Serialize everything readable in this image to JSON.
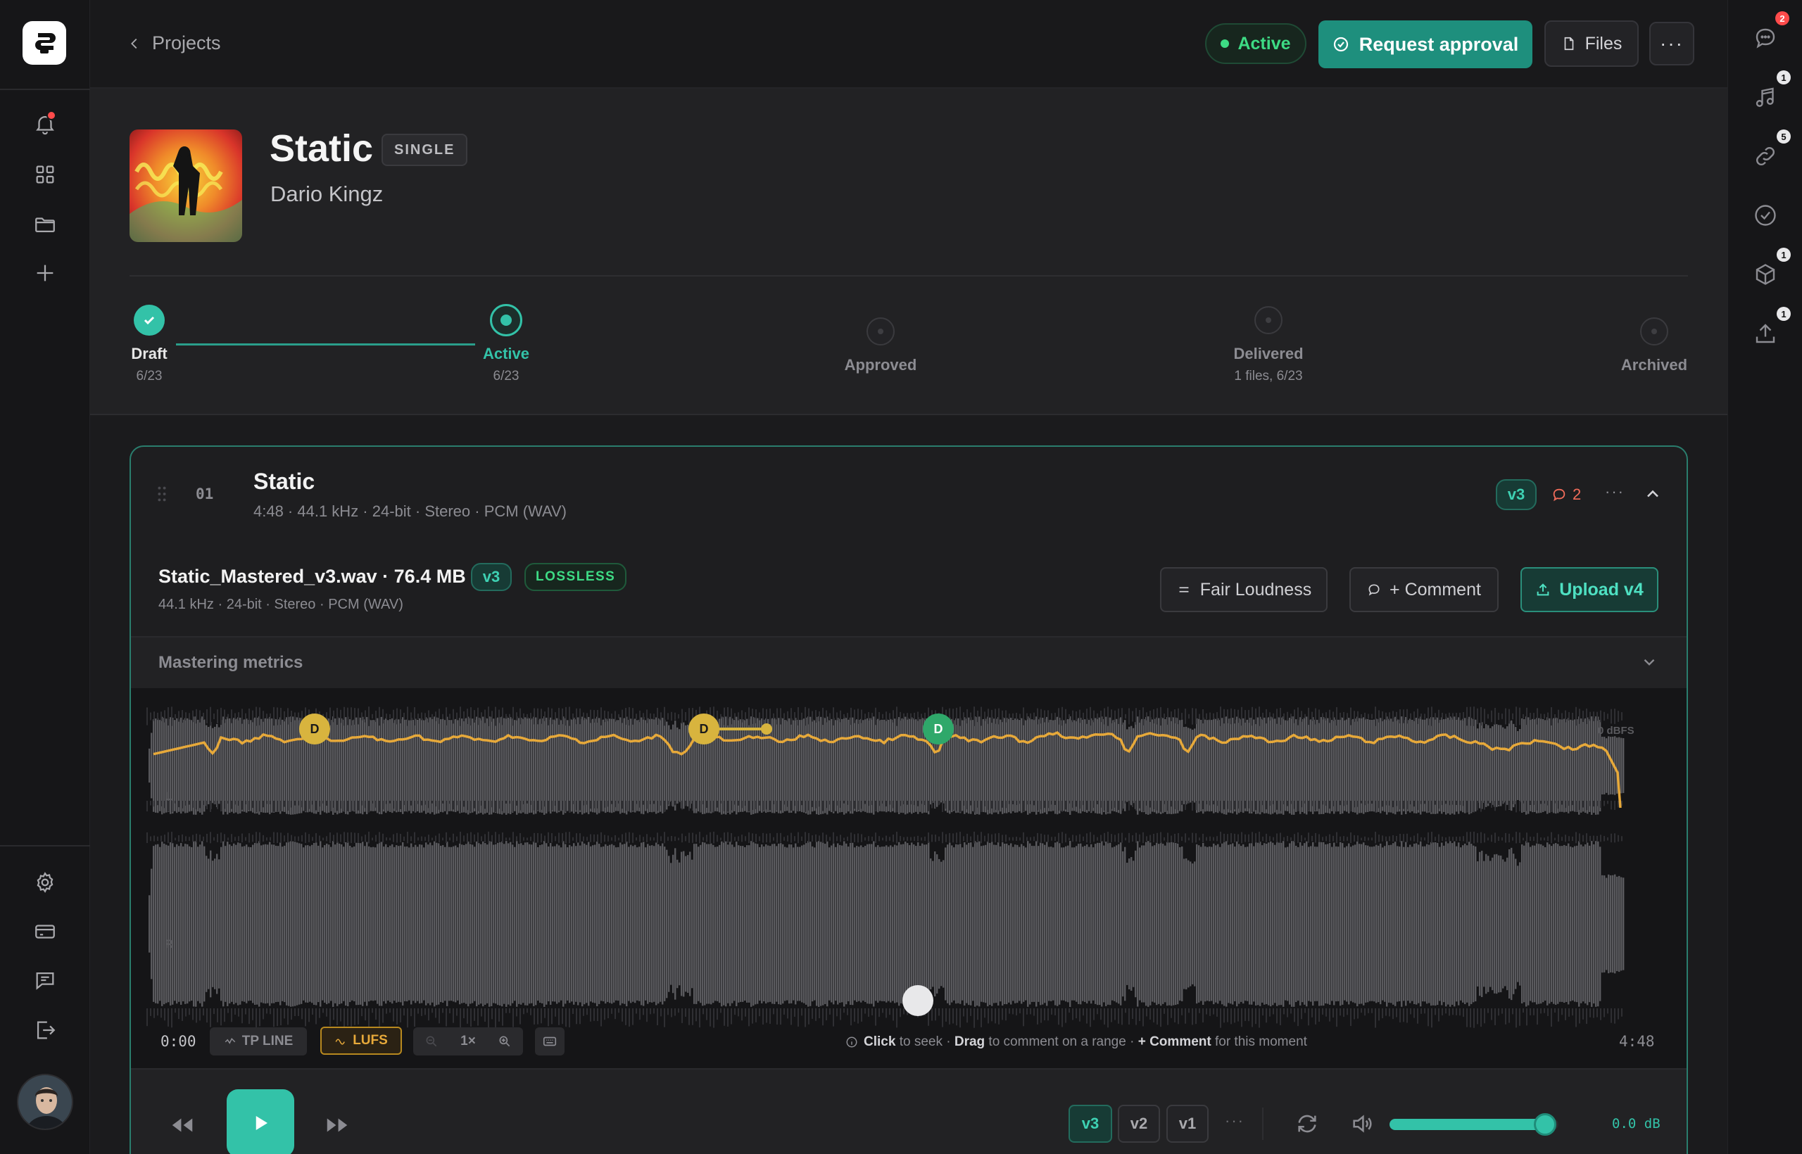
{
  "nav": {
    "items": [
      {
        "icon": "bell-icon"
      },
      {
        "icon": "grid-icon"
      },
      {
        "icon": "folder-icon"
      },
      {
        "icon": "plus-icon"
      }
    ],
    "bottom_items": [
      {
        "icon": "gear-icon"
      },
      {
        "icon": "card-icon"
      },
      {
        "icon": "feedback-icon"
      },
      {
        "icon": "logout-icon"
      }
    ]
  },
  "header": {
    "back_label": "Projects",
    "status_label": "Active",
    "approve_label": "Request approval",
    "files_label": "Files",
    "more_label": "···"
  },
  "rail": {
    "items": [
      {
        "icon": "chat-icon",
        "badge": "2"
      },
      {
        "icon": "music-note-icon",
        "badge": "1"
      },
      {
        "icon": "link-icon",
        "badge": "5"
      },
      {
        "icon": "check-circle-icon",
        "badge": ""
      },
      {
        "icon": "box-icon",
        "badge": "1"
      },
      {
        "icon": "upload-icon",
        "badge": "1"
      }
    ]
  },
  "project": {
    "title": "Static",
    "type": "SINGLE",
    "artist": "Dario Kingz"
  },
  "stepper": {
    "steps": [
      {
        "label": "Draft",
        "date": "6/23",
        "state": "done"
      },
      {
        "label": "Active",
        "date": "6/23",
        "state": "current"
      },
      {
        "label": "Approved",
        "date": "",
        "state": "pending"
      },
      {
        "label": "Delivered",
        "date": "1 files, 6/23",
        "state": "pending"
      },
      {
        "label": "Archived",
        "date": "",
        "state": "pending"
      }
    ]
  },
  "track": {
    "number": "01",
    "title": "Static",
    "meta": "4:48 · 44.1 kHz · 24-bit · Stereo · PCM (WAV)",
    "version": "v3",
    "comment_count": "2",
    "more_label": "···",
    "file": {
      "name": "Static_Mastered_v3.wav · 76.4 MB",
      "version": "v3",
      "quality": "LOSSLESS",
      "meta": "44.1 kHz · 24-bit · Stereo · PCM (WAV)"
    },
    "actions": {
      "fair_loudness": "Fair Loudness",
      "comment": "+ Comment",
      "upload": "Upload v4"
    },
    "metrics_label": "Mastering metrics"
  },
  "waveform": {
    "markers": [
      "D",
      "D",
      "D"
    ],
    "db_label": "0 dBFS",
    "channel_l": "L",
    "channel_r": "R",
    "playhead_fraction": 0.506,
    "start_time": "0:00",
    "end_time": "4:48",
    "tp_line_label": "TP LINE",
    "lufs_label": "LUFS",
    "zoom_label": "1×",
    "hint_click": "Click",
    "hint_seek": " to seek · ",
    "hint_drag": "Drag",
    "hint_range": " to comment on a range · ",
    "hint_comment": "+ Comment",
    "hint_moment": " for this moment",
    "colors": {
      "lufs": "#e7a93a",
      "wave": "#5a5a5e",
      "marker_gold": "#d8b43e",
      "marker_green": "#2fa86a"
    }
  },
  "player": {
    "versions": [
      "v3",
      "v2",
      "v1"
    ],
    "active_version": "v3",
    "more_label": "···",
    "volume_fraction": 0.92,
    "gain_label": "0.0 dB"
  }
}
